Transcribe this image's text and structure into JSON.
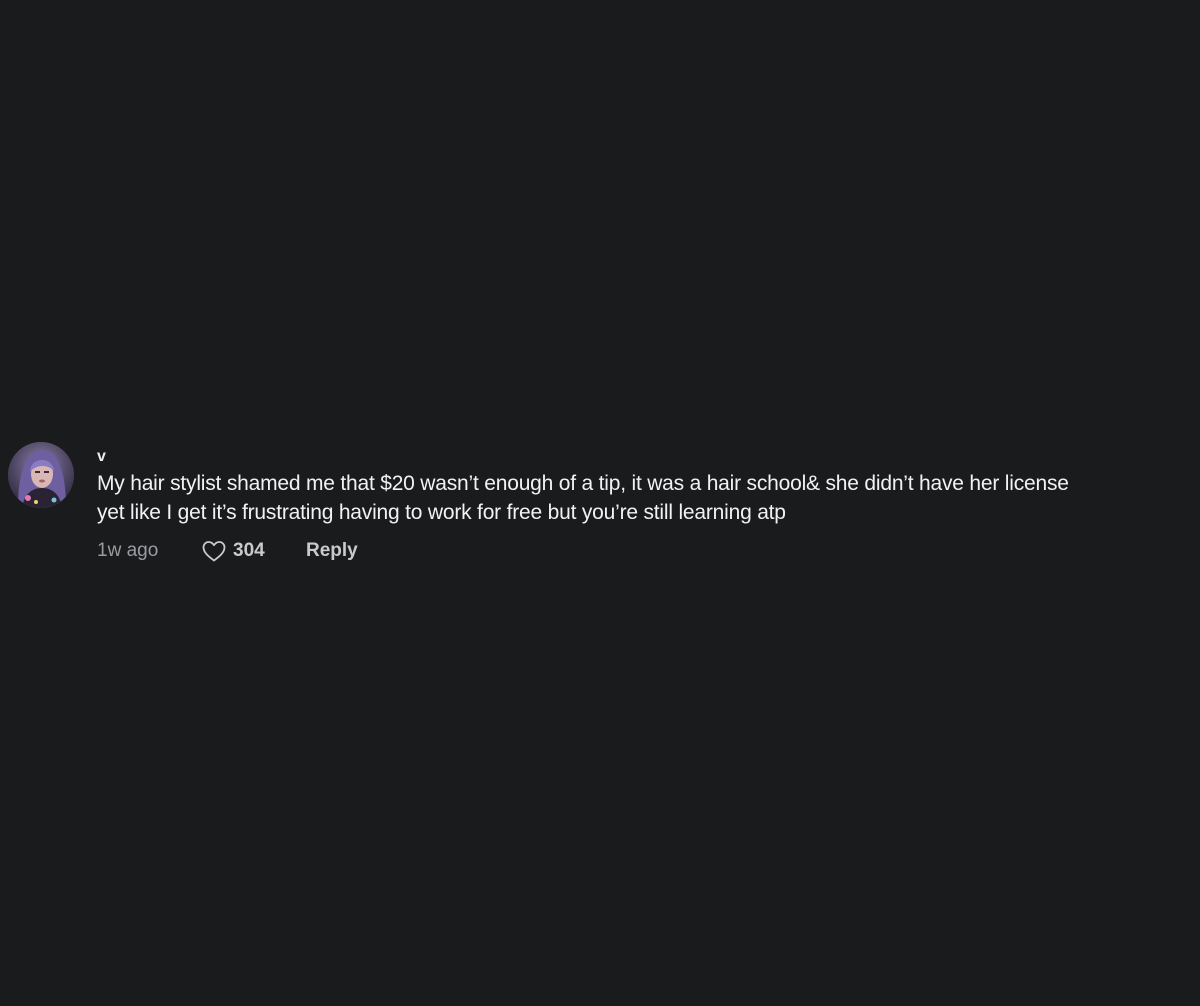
{
  "comment": {
    "username": "v",
    "text_line1": "My hair stylist shamed me that $20 wasn’t enough of a tip, it was a hair school& she didn’t have her license",
    "text_line2": "yet like I get it’s frustrating having to work for free but you’re still learning atp",
    "time": "1w ago",
    "likes": "304",
    "reply_label": "Reply",
    "avatar_icon": "user-avatar-photo",
    "like_icon": "heart-outline-icon"
  },
  "colors": {
    "background": "#1a1b1d",
    "text_primary": "#f2f2f3",
    "text_secondary": "#9b9ca0"
  }
}
